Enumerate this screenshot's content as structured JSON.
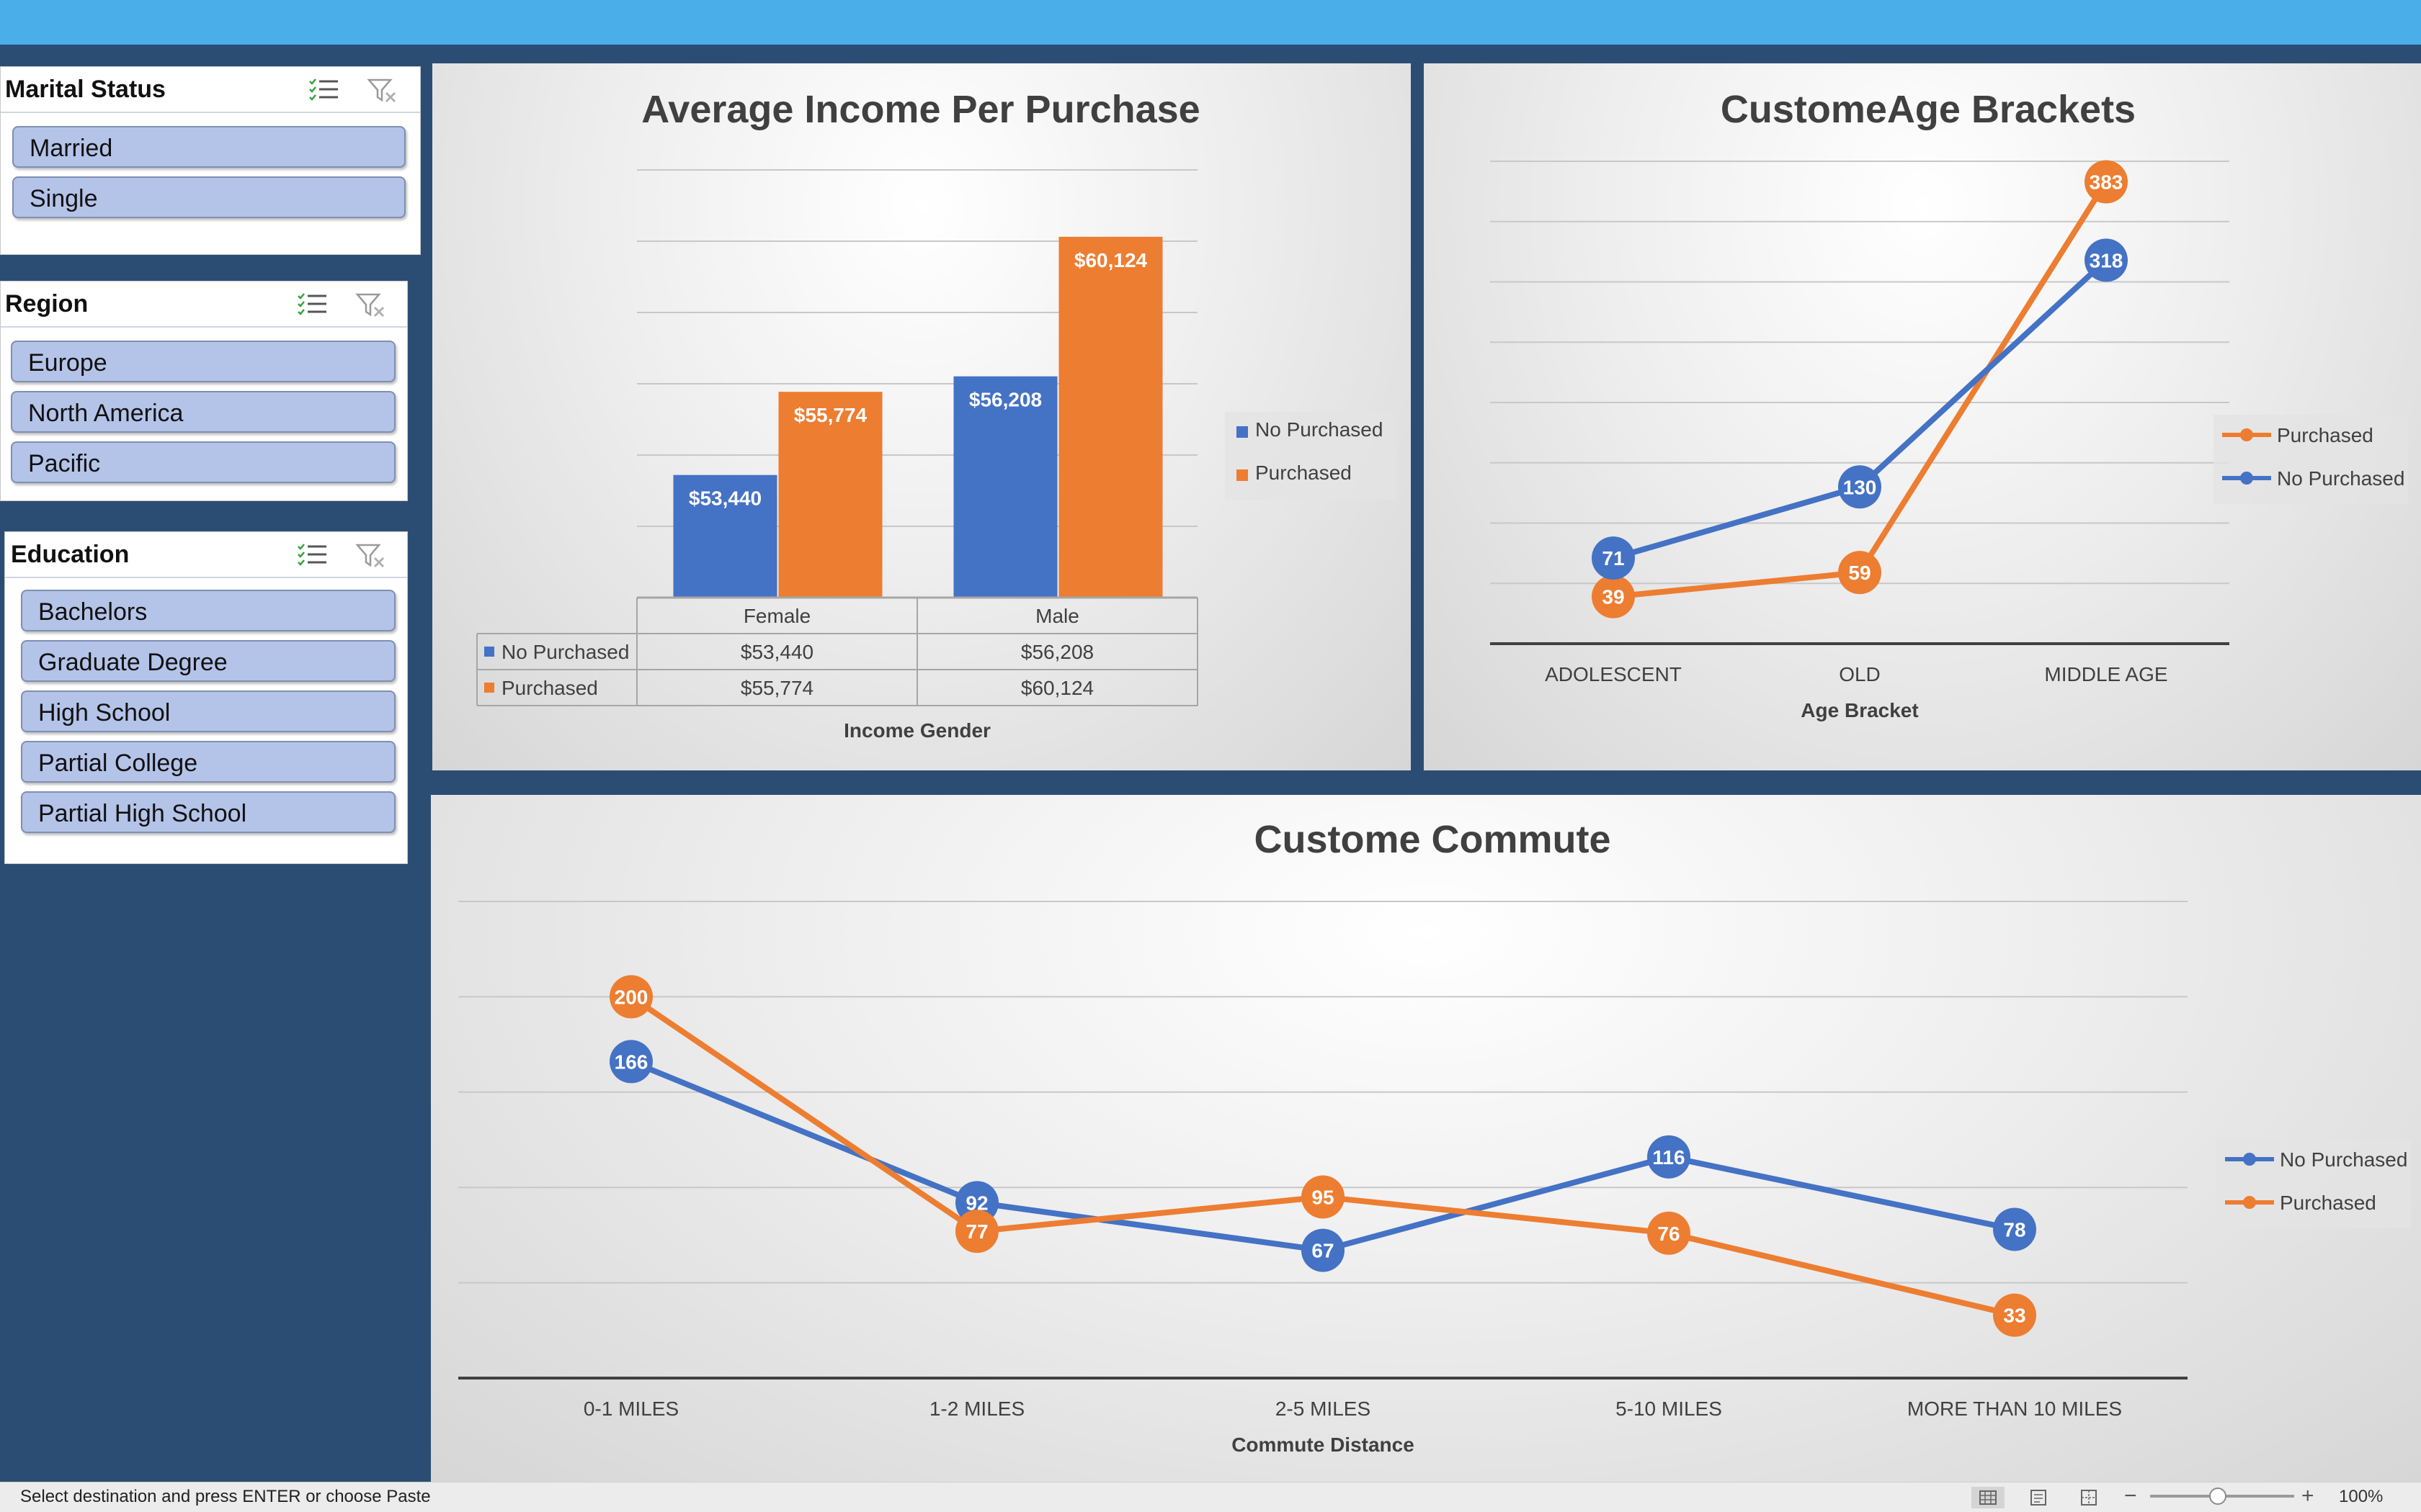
{
  "slicers": {
    "marital_status": {
      "title": "Marital Status",
      "items": [
        "Married",
        "Single"
      ]
    },
    "region": {
      "title": "Region",
      "items": [
        "Europe",
        "North America",
        "Pacific"
      ]
    },
    "education": {
      "title": "Education",
      "items": [
        "Bachelors",
        "Graduate Degree",
        "High School",
        "Partial College",
        "Partial High School"
      ]
    }
  },
  "colors": {
    "no_purchased": "#4472c4",
    "purchased": "#ed7d31",
    "band": "#4aaee8",
    "background": "#2b4d74",
    "slicer_item": "#b4c3e8"
  },
  "chart_data": [
    {
      "type": "bar",
      "title": "Average Income Per Purchase",
      "xlabel": "Income Gender",
      "ylabel": "",
      "categories": [
        "Female",
        "Male"
      ],
      "ylim": [
        50000,
        62000
      ],
      "grid": true,
      "legend_position": "right",
      "series": [
        {
          "name": "No Purchased",
          "values": [
            53440,
            56208
          ],
          "labels": [
            "$53,440",
            "$56,208"
          ]
        },
        {
          "name": "Purchased",
          "values": [
            55774,
            60124
          ],
          "labels": [
            "$55,774",
            "$60,124"
          ]
        }
      ]
    },
    {
      "type": "line",
      "title": "CustomeAge Brackets",
      "xlabel": "Age Bracket",
      "ylabel": "",
      "categories": [
        "ADOLESCENT",
        "OLD",
        "MIDDLE AGE"
      ],
      "ylim": [
        0,
        400
      ],
      "grid": true,
      "legend_position": "right",
      "series": [
        {
          "name": "Purchased",
          "values": [
            39,
            59,
            383
          ]
        },
        {
          "name": "No Purchased",
          "values": [
            71,
            130,
            318
          ]
        }
      ]
    },
    {
      "type": "line",
      "title": "Custome Commute",
      "xlabel": "Commute Distance",
      "ylabel": "",
      "categories": [
        "0-1 MILES",
        "1-2 MILES",
        "2-5 MILES",
        "5-10 MILES",
        "MORE THAN 10 MILES"
      ],
      "ylim": [
        0,
        250
      ],
      "grid": true,
      "legend_position": "right",
      "series": [
        {
          "name": "No Purchased",
          "values": [
            166,
            92,
            67,
            116,
            78
          ]
        },
        {
          "name": "Purchased",
          "values": [
            200,
            77,
            95,
            76,
            33
          ]
        }
      ]
    }
  ],
  "statusbar": {
    "message": "Select destination and press ENTER or choose Paste",
    "zoom": "100%"
  }
}
